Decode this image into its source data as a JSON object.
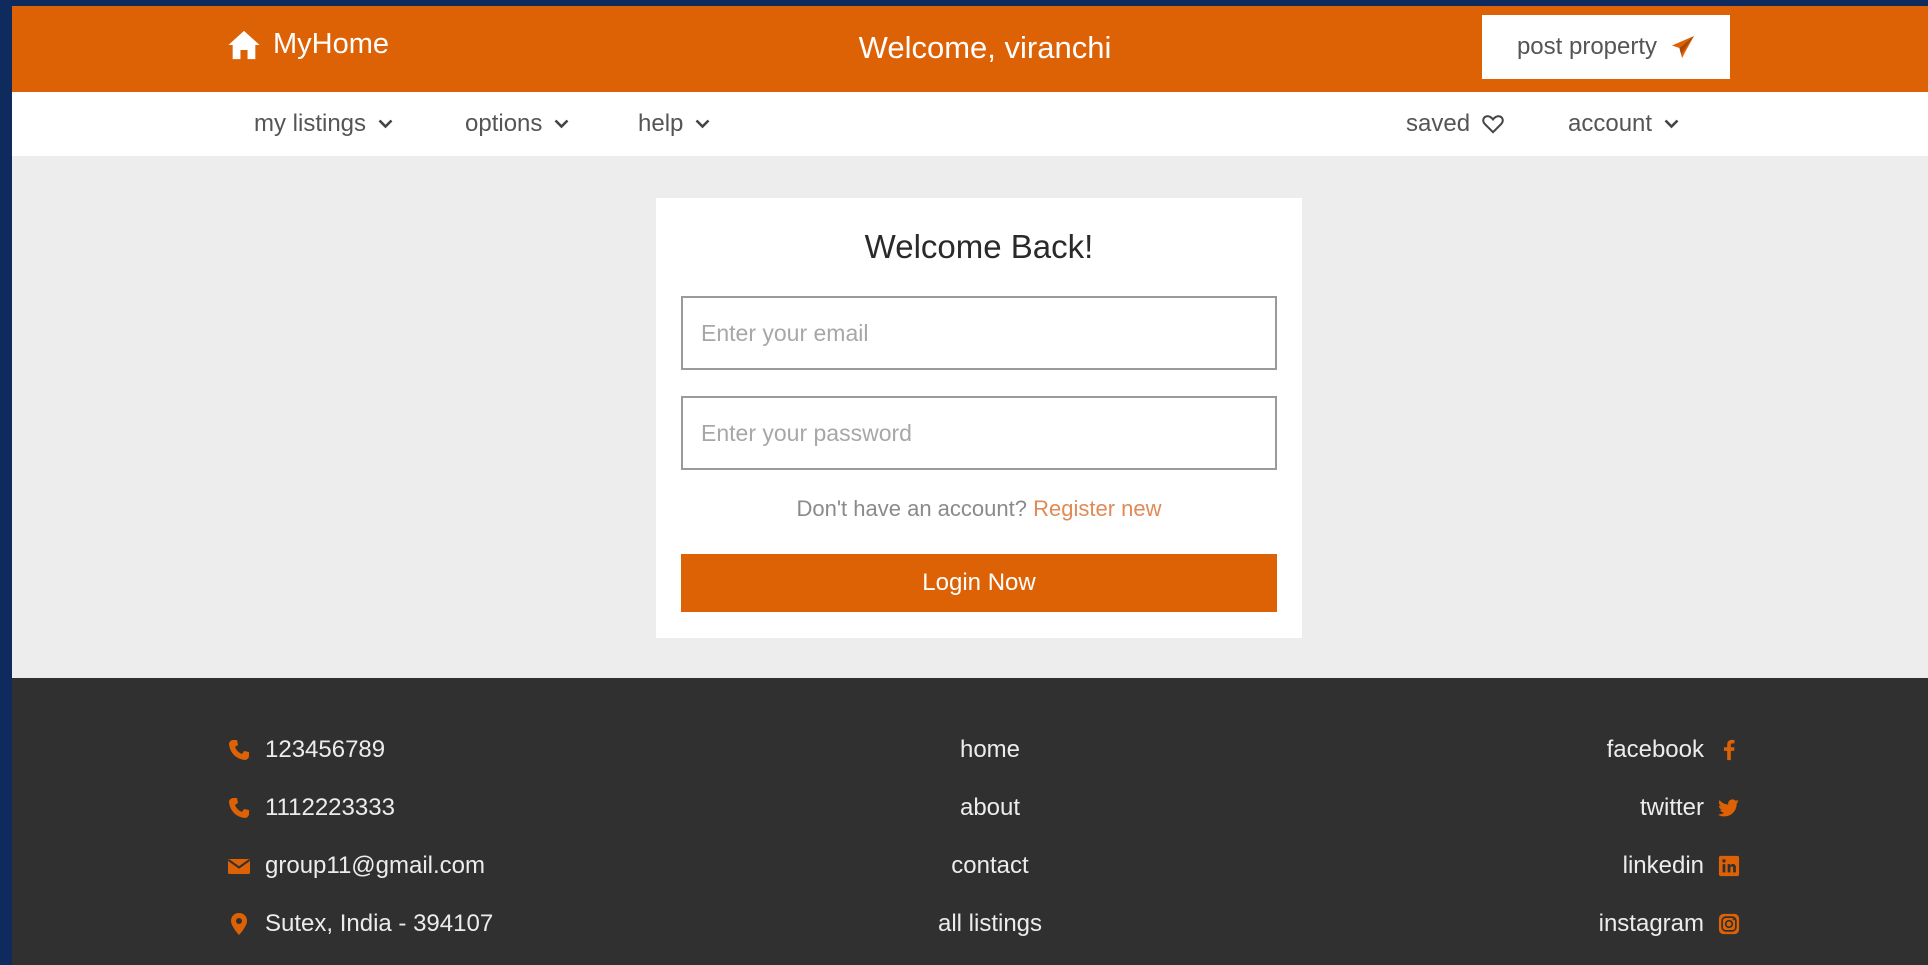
{
  "header": {
    "brand_name": "MyHome",
    "welcome_text": "Welcome, viranchi",
    "post_property_label": "post property"
  },
  "nav": {
    "left_items": [
      {
        "label": "my listings"
      },
      {
        "label": "options"
      },
      {
        "label": "help"
      }
    ],
    "saved_label": "saved",
    "account_label": "account"
  },
  "login": {
    "title": "Welcome Back!",
    "email_placeholder": "Enter your email",
    "password_placeholder": "Enter your password",
    "register_prompt": "Don't have an account?",
    "register_link": "Register new",
    "login_button": "Login Now"
  },
  "footer": {
    "contacts": [
      {
        "icon": "phone-icon",
        "text": "123456789"
      },
      {
        "icon": "phone-icon",
        "text": "1112223333"
      },
      {
        "icon": "mail-icon",
        "text": "group11@gmail.com"
      },
      {
        "icon": "location-pin-icon",
        "text": "Sutex, India - 394107"
      }
    ],
    "links": [
      "home",
      "about",
      "contact",
      "all listings"
    ],
    "socials": [
      {
        "label": "facebook",
        "icon": "facebook-icon"
      },
      {
        "label": "twitter",
        "icon": "twitter-icon"
      },
      {
        "label": "linkedin",
        "icon": "linkedin-icon"
      },
      {
        "label": "instagram",
        "icon": "instagram-icon"
      }
    ]
  },
  "colors": {
    "brand_orange": "#dd6105",
    "footer_bg": "#303030",
    "page_bg": "#ededed",
    "outer_bg": "#0f2a5c"
  }
}
